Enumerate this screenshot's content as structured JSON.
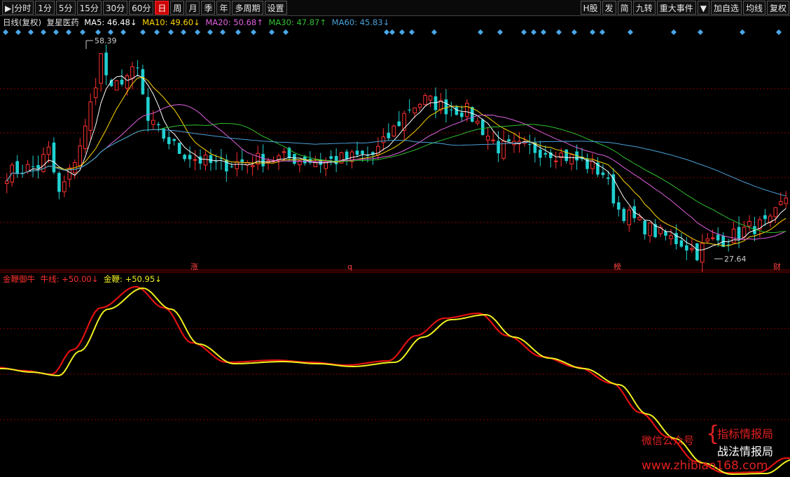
{
  "toolbar": {
    "left_items": [
      {
        "label": "▶|分时",
        "active": false
      },
      {
        "label": "1分",
        "active": false
      },
      {
        "label": "5分",
        "active": false
      },
      {
        "label": "15分",
        "active": false
      },
      {
        "label": "30分",
        "active": false
      },
      {
        "label": "60分",
        "active": false
      },
      {
        "label": "日",
        "active": true
      },
      {
        "label": "周",
        "active": false
      },
      {
        "label": "月",
        "active": false
      },
      {
        "label": "季",
        "active": false
      },
      {
        "label": "年",
        "active": false
      },
      {
        "label": "多周期",
        "active": false
      },
      {
        "label": "设置",
        "active": false
      }
    ],
    "right_items": [
      {
        "label": "H股"
      },
      {
        "label": "发"
      },
      {
        "label": "简"
      },
      {
        "label": "九转"
      },
      {
        "label": "重大事件"
      },
      {
        "label": "▼"
      },
      {
        "label": "加自选"
      },
      {
        "label": "均线"
      },
      {
        "label": "复权"
      }
    ]
  },
  "main_info": {
    "period": "日线(复权)",
    "stock": "复星医药",
    "ma5": "MA5: 46.48↓",
    "ma10": "MA10: 49.60↓",
    "ma20": "MA20: 50.68↑",
    "ma30": "MA30: 47.87↑",
    "ma60": "MA60: 45.83↓"
  },
  "sub_info": {
    "name": "金鞭御牛",
    "line1": "牛线: +50.00↓",
    "line2": "金鞭: +50.95↓"
  },
  "price_labels": {
    "high": "58.39",
    "low": "27.64"
  },
  "event_labels": [
    "涨",
    "q",
    "榜",
    "财"
  ],
  "watermark": {
    "public_account": "微信公众号",
    "line1": "指标情报局",
    "line2": "战法情报局",
    "url": "www.zhibiao168.com"
  },
  "colors": {
    "up": "#ff3030",
    "down": "#20d0d0",
    "ma5": "#ffffff",
    "ma10": "#ffd700",
    "ma20": "#e060e0",
    "ma30": "#30c030",
    "ma60": "#4aa0d8",
    "niu": "#e01010",
    "jinbian": "#f0f020",
    "grid": "#8b0000"
  },
  "chart_data": {
    "type": "candlestick",
    "price_range": [
      27.64,
      58.39
    ],
    "series": [
      {
        "name": "MA5",
        "values": []
      },
      {
        "name": "MA10",
        "values": []
      },
      {
        "name": "MA20",
        "values": []
      },
      {
        "name": "MA30",
        "values": []
      },
      {
        "name": "MA60",
        "values": []
      },
      {
        "name": "牛线",
        "values": []
      },
      {
        "name": "金鞭",
        "values": []
      }
    ]
  }
}
